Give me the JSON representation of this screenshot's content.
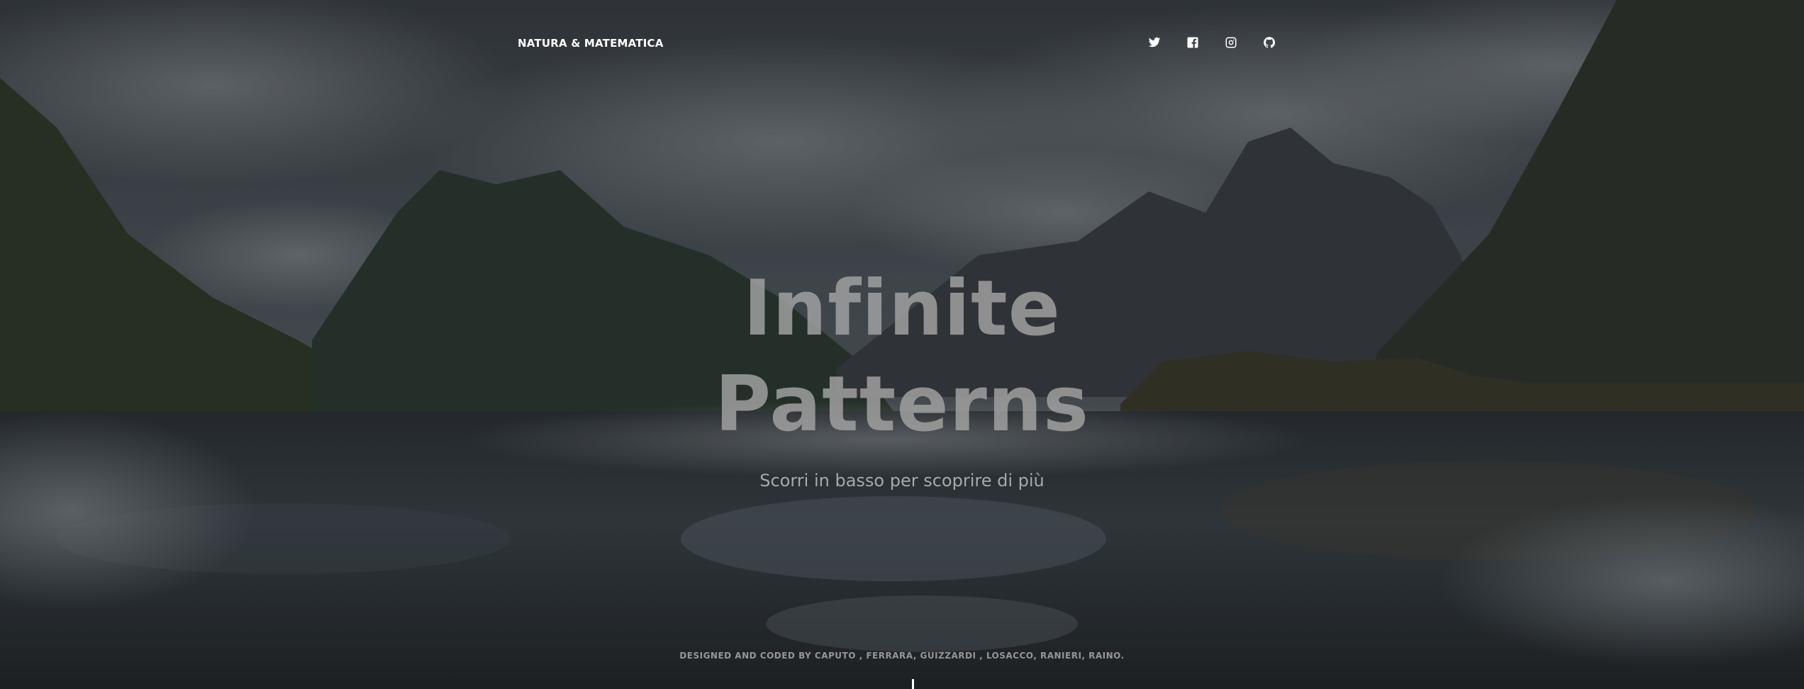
{
  "header": {
    "brand": "NATURA & MATEMATICA",
    "social": [
      {
        "icon": "twitter-icon"
      },
      {
        "icon": "facebook-icon"
      },
      {
        "icon": "instagram-icon"
      },
      {
        "icon": "github-icon"
      }
    ]
  },
  "hero": {
    "title_line1": "Infinite",
    "title_line2": "Patterns",
    "subtitle": "Scorri in basso per scoprire di più"
  },
  "footer": {
    "credits": "DESIGNED AND CODED BY CAPUTO , FERRARA, GUIZZARDI , LOSACCO, RANIERI, RAINO."
  },
  "colors": {
    "text": "#ffffff",
    "overlay": "#1a1d20"
  }
}
